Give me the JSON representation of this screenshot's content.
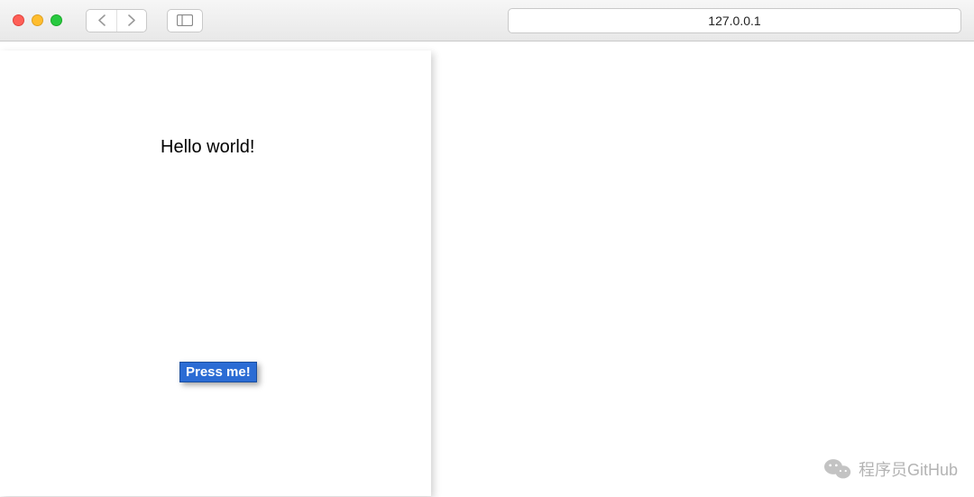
{
  "browser": {
    "address": "127.0.0.1"
  },
  "app": {
    "heading": "Hello world!",
    "button_label": "Press me!"
  },
  "watermark": {
    "text": "程序员GitHub"
  }
}
